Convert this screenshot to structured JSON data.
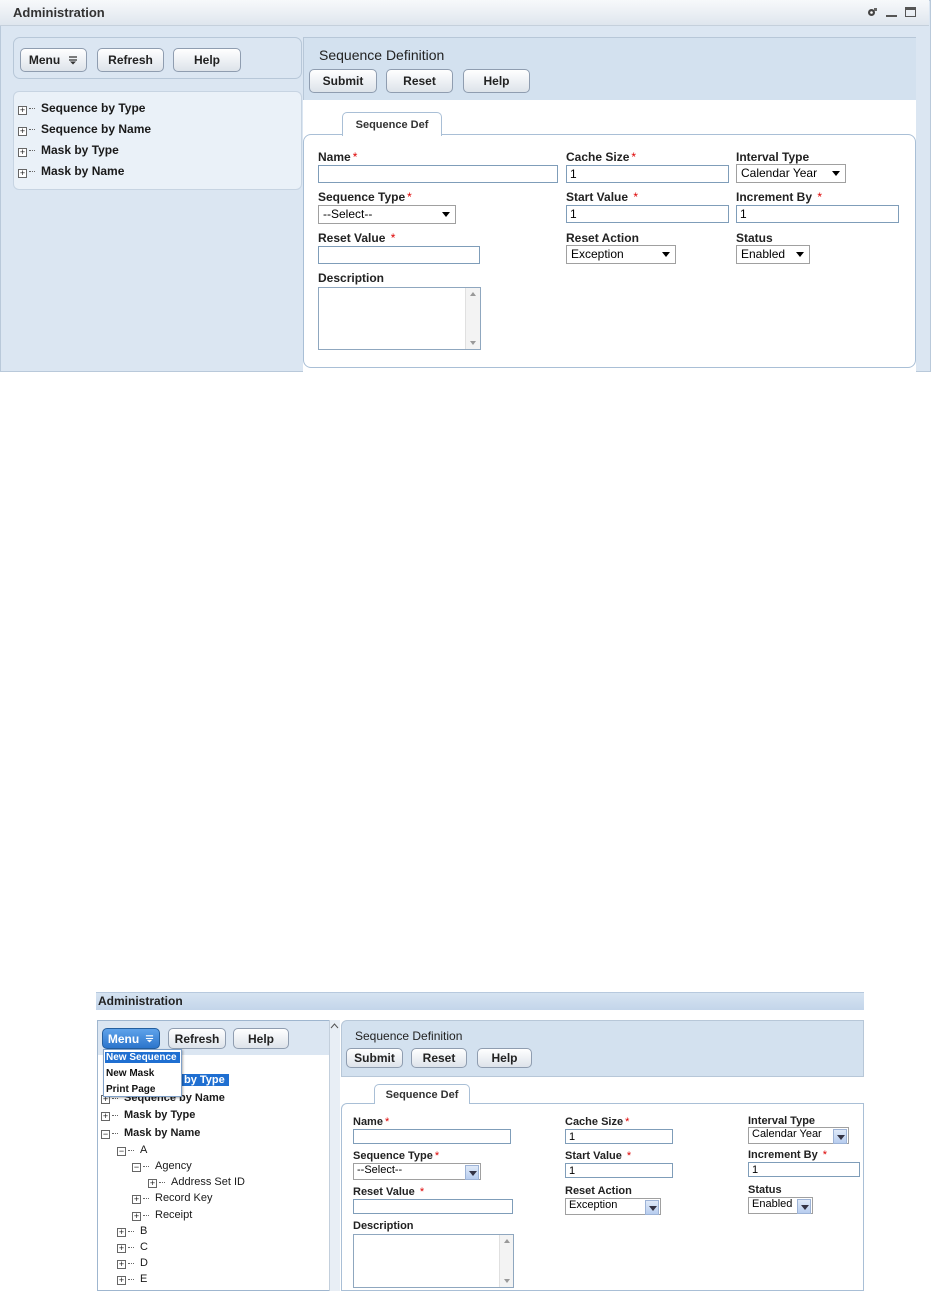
{
  "window": {
    "title": "Administration"
  },
  "left_toolbar": {
    "menu_label": "Menu",
    "refresh_label": "Refresh",
    "help_label": "Help"
  },
  "tree": {
    "items": [
      {
        "label": "Sequence by Type"
      },
      {
        "label": "Sequence by Name"
      },
      {
        "label": "Mask by Type"
      },
      {
        "label": "Mask by Name"
      }
    ]
  },
  "main": {
    "heading": "Sequence Definition",
    "submit_label": "Submit",
    "reset_label": "Reset",
    "help_label": "Help",
    "tab_label": "Sequence Def"
  },
  "form": {
    "name_label": "Name",
    "name_value": "",
    "cache_size_label": "Cache Size",
    "cache_size_value": "1",
    "interval_type_label": "Interval Type",
    "interval_type_value": "Calendar Year",
    "sequence_type_label": "Sequence Type",
    "sequence_type_value": "--Select--",
    "start_value_label": "Start Value",
    "start_value_value": "1",
    "increment_by_label": "Increment By",
    "increment_by_value": "1",
    "reset_value_label": "Reset Value",
    "reset_value_value": "",
    "reset_action_label": "Reset Action",
    "reset_action_value": "Exception",
    "status_label": "Status",
    "status_value": "Enabled",
    "description_label": "Description",
    "description_value": "",
    "required_mark": "*"
  },
  "second_view": {
    "title": "Administration",
    "menu_label": "Menu",
    "refresh_label": "Refresh",
    "help_label": "Help",
    "menu_items": [
      "New Sequence",
      "New Mask",
      "Print Page"
    ],
    "tree_visible_fragment": "by Type",
    "tree": [
      {
        "label": "Sequence by Name"
      },
      {
        "label": "Mask by Type"
      },
      {
        "label": "Mask by Name"
      },
      {
        "label": "A"
      },
      {
        "label": "Agency"
      },
      {
        "label": "Address Set ID"
      },
      {
        "label": "Record Key"
      },
      {
        "label": "Receipt"
      },
      {
        "label": "B"
      },
      {
        "label": "C"
      },
      {
        "label": "D"
      },
      {
        "label": "E"
      }
    ],
    "heading": "Sequence Definition",
    "submit_label": "Submit",
    "reset_label": "Reset",
    "tab_label": "Sequence Def"
  },
  "colors": {
    "panel_bg": "#dbe6f2",
    "required": "#dd0000",
    "menu_highlight": "#1f6fd1"
  }
}
